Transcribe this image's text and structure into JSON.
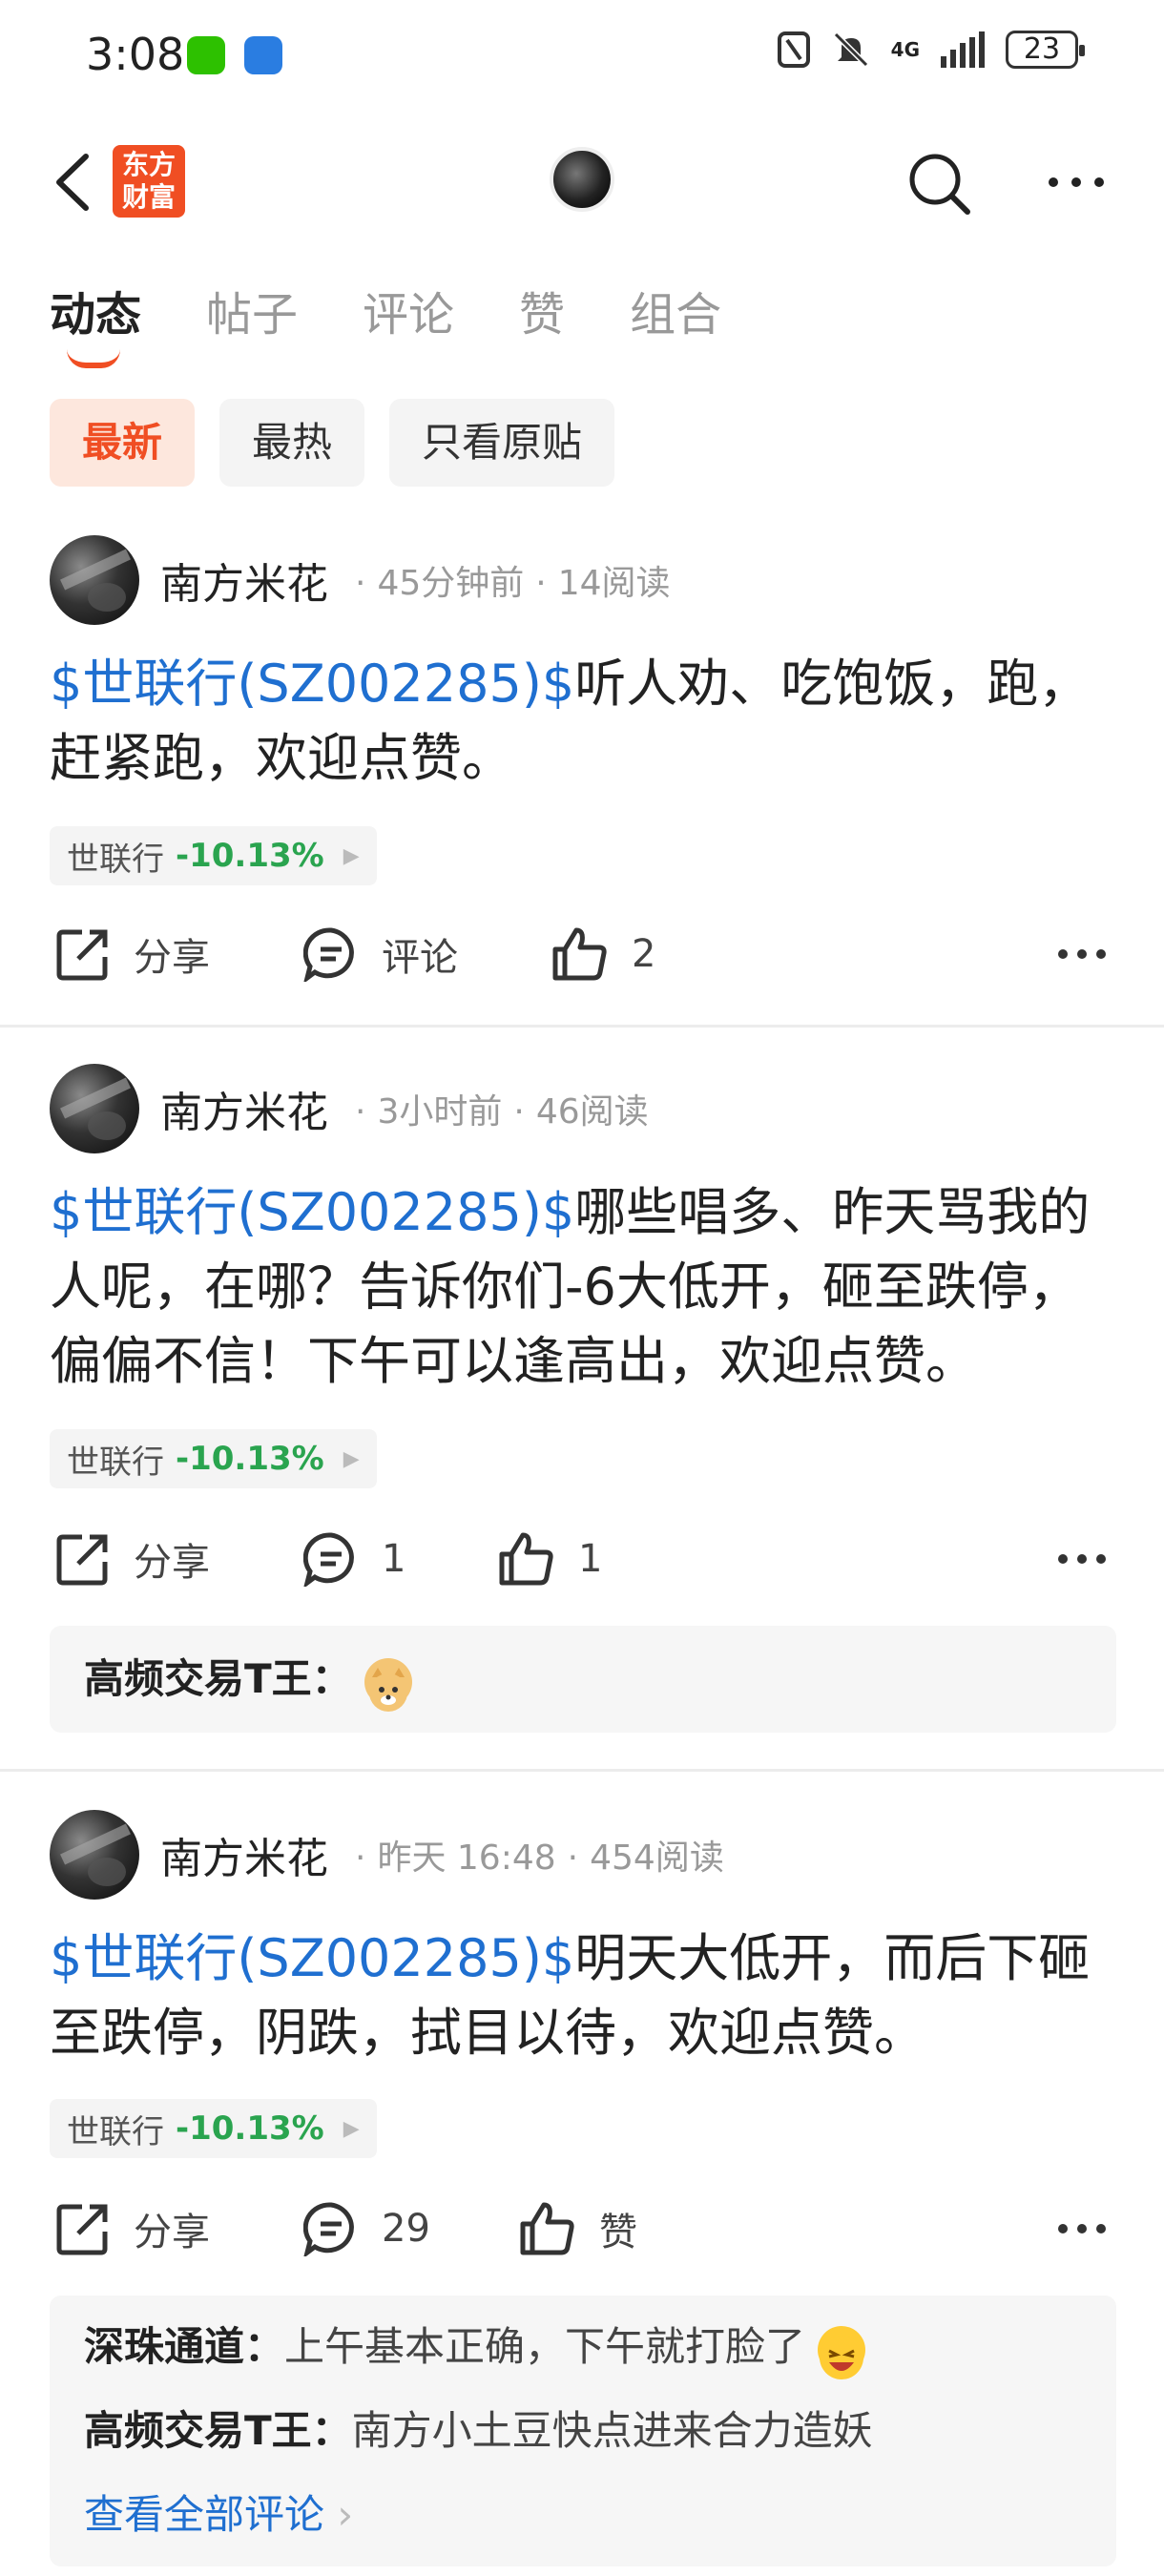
{
  "status_bar": {
    "time": "3:08",
    "network": "4G",
    "battery": "23"
  },
  "nav": {
    "logo_text_line1": "东方",
    "logo_text_line2": "财富"
  },
  "tabs": [
    {
      "label": "动态",
      "active": true
    },
    {
      "label": "帖子",
      "active": false
    },
    {
      "label": "评论",
      "active": false
    },
    {
      "label": "赞",
      "active": false
    },
    {
      "label": "组合",
      "active": false
    }
  ],
  "filters": [
    {
      "label": "最新",
      "active": true
    },
    {
      "label": "最热",
      "active": false
    },
    {
      "label": "只看原贴",
      "active": false
    }
  ],
  "posts": [
    {
      "author": "南方米花",
      "time": "45分钟前",
      "reads": "14阅读",
      "stock_link": "$世联行(SZ002285)$",
      "text_line1": "听人劝、吃饱饭，跑，",
      "text_line2": "赶紧跑，欢迎点赞。",
      "text_line3": "",
      "chip_name": "世联行",
      "chip_change": "-10.13%",
      "share": "分享",
      "comment": "评论",
      "like": "2"
    },
    {
      "author": "南方米花",
      "time": "3小时前",
      "reads": "46阅读",
      "stock_link": "$世联行(SZ002285)$",
      "text_line1": "哪些唱多、昨天骂我的",
      "text_line2": "人呢，在哪？告诉你们-6大低开，砸至跌停，",
      "text_line3": "偏偏不信！下午可以逢高出，欢迎点赞。",
      "chip_name": "世联行",
      "chip_change": "-10.13%",
      "share": "分享",
      "comment": "1",
      "like": "1",
      "comments": [
        {
          "user": "高频交易T王：",
          "text": ""
        }
      ]
    },
    {
      "author": "南方米花",
      "time": "昨天 16:48",
      "reads": "454阅读",
      "stock_link": "$世联行(SZ002285)$",
      "text_line1": "明天大低开，而后下砸",
      "text_line2": "至跌停，阴跌，拭目以待，欢迎点赞。",
      "text_line3": "",
      "chip_name": "世联行",
      "chip_change": "-10.13%",
      "share": "分享",
      "comment": "29",
      "like": "赞",
      "comments": [
        {
          "user": "深珠通道：",
          "text": "上午基本正确，下午就打脸了"
        },
        {
          "user": "高频交易T王：",
          "text": "南方小土豆快点进来合力造妖"
        }
      ],
      "view_all": "查看全部评论"
    }
  ],
  "colors": {
    "accent": "#f04e23",
    "link": "#1f6fd0",
    "down": "#2aa44f"
  }
}
